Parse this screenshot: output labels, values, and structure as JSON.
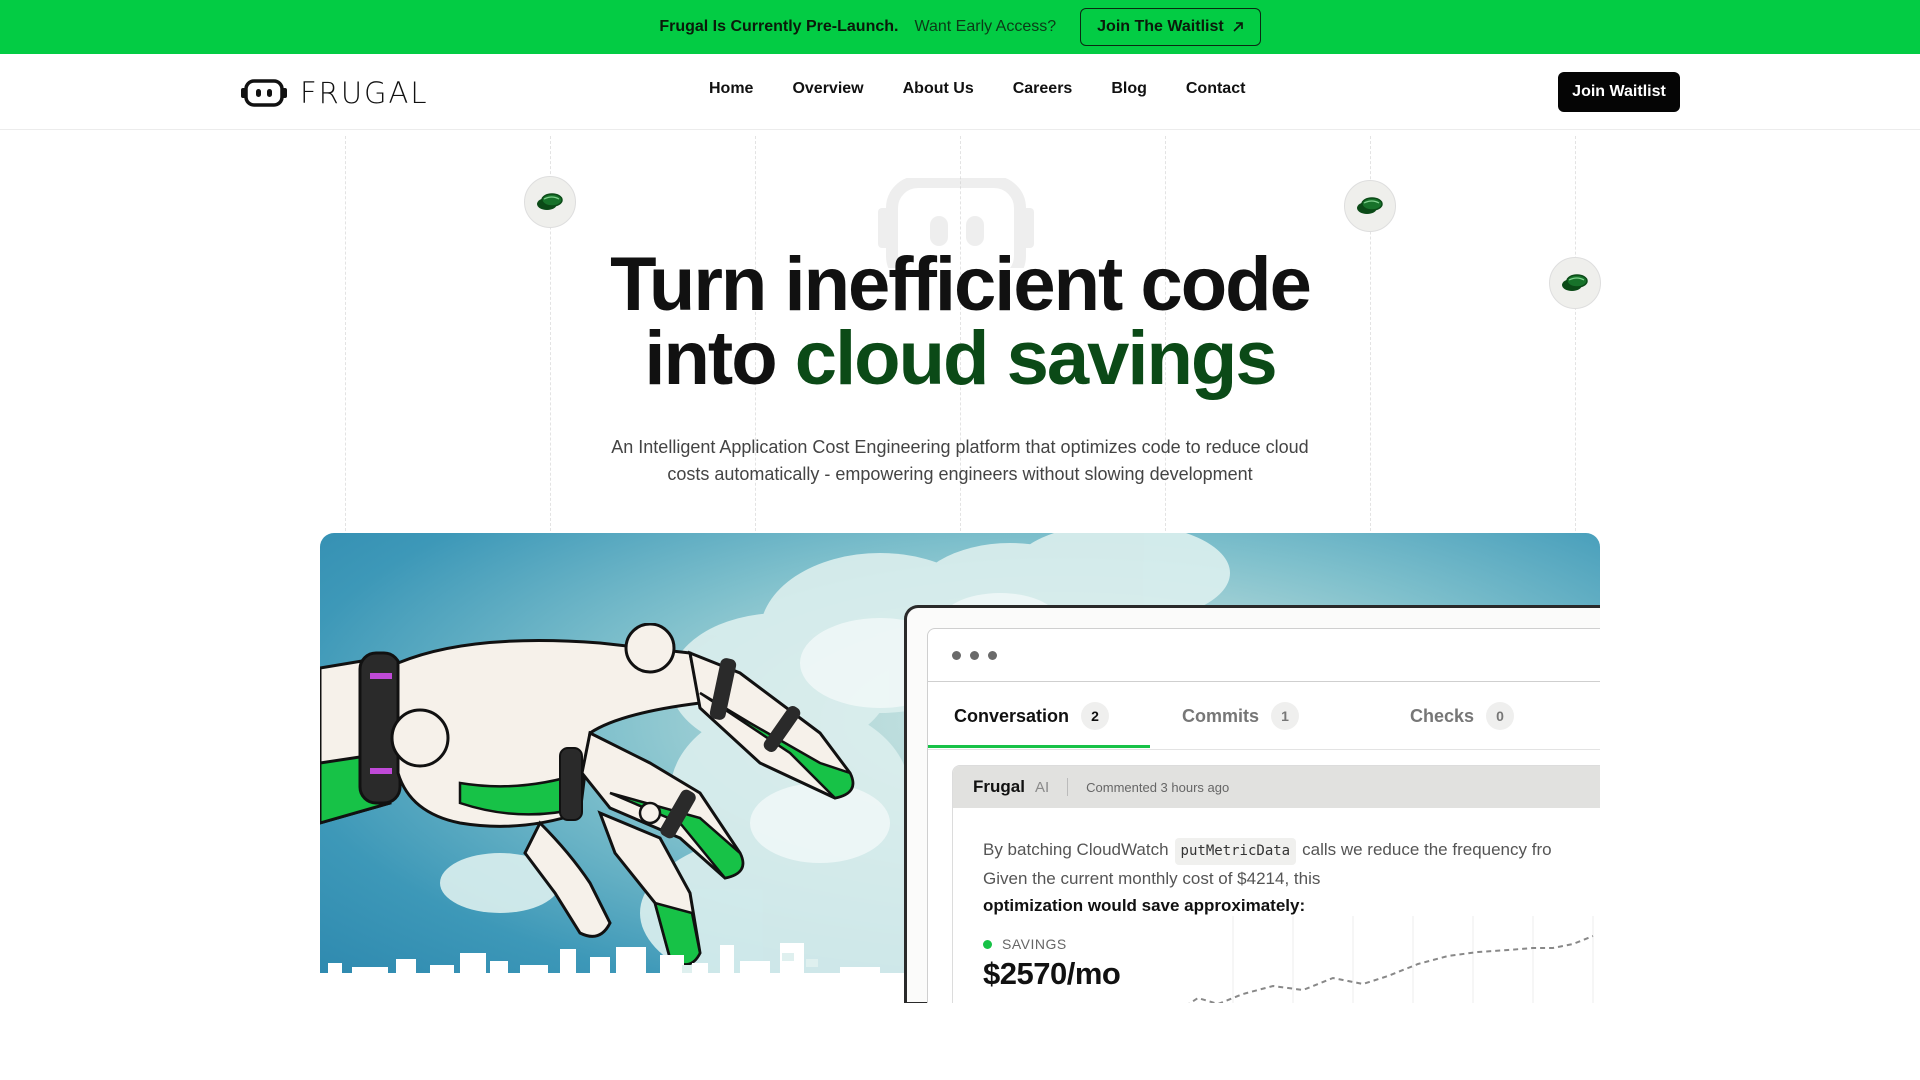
{
  "announcement": {
    "status": "Frugal Is Currently Pre-Launch.",
    "prompt": "Want Early Access?",
    "cta": "Join The Waitlist",
    "cta_icon": "arrow-up-right-icon"
  },
  "brand": {
    "name": "FRUGAL",
    "logo_icon": "robot-face-icon"
  },
  "nav": {
    "items": [
      "Home",
      "Overview",
      "About Us",
      "Careers",
      "Blog",
      "Contact"
    ],
    "cta": "Join Waitlist"
  },
  "hero": {
    "title_line1": "Turn inefficient code",
    "title_line2_plain": "into",
    "title_line2_accent": "cloud savings",
    "subtitle_line1": "An Intelligent Application Cost Engineering platform that optimizes code to reduce cloud",
    "subtitle_line2": "costs automatically - empowering engineers without slowing development",
    "floating_icon": "coins-icon"
  },
  "demo": {
    "tabs": [
      {
        "label": "Conversation",
        "count": "2",
        "active": true
      },
      {
        "label": "Commits",
        "count": "1",
        "active": false
      },
      {
        "label": "Checks",
        "count": "0",
        "active": false
      }
    ],
    "comment": {
      "author": "Frugal",
      "tag": "AI",
      "time": "Commented 3 hours ago",
      "text_before_code": "By batching CloudWatch",
      "code": "putMetricData",
      "text_after_code": "calls we reduce the frequency fro",
      "line2": "Given the current monthly cost of $4214, this",
      "line3": "optimization would save approximately:",
      "savings_label": "SAVINGS",
      "savings_value": "$2570/mo"
    }
  },
  "colors": {
    "announcement_bg": "#03cc44",
    "accent_green": "#0b4a17",
    "tab_underline": "#17c247",
    "cta_bg": "#050505"
  }
}
